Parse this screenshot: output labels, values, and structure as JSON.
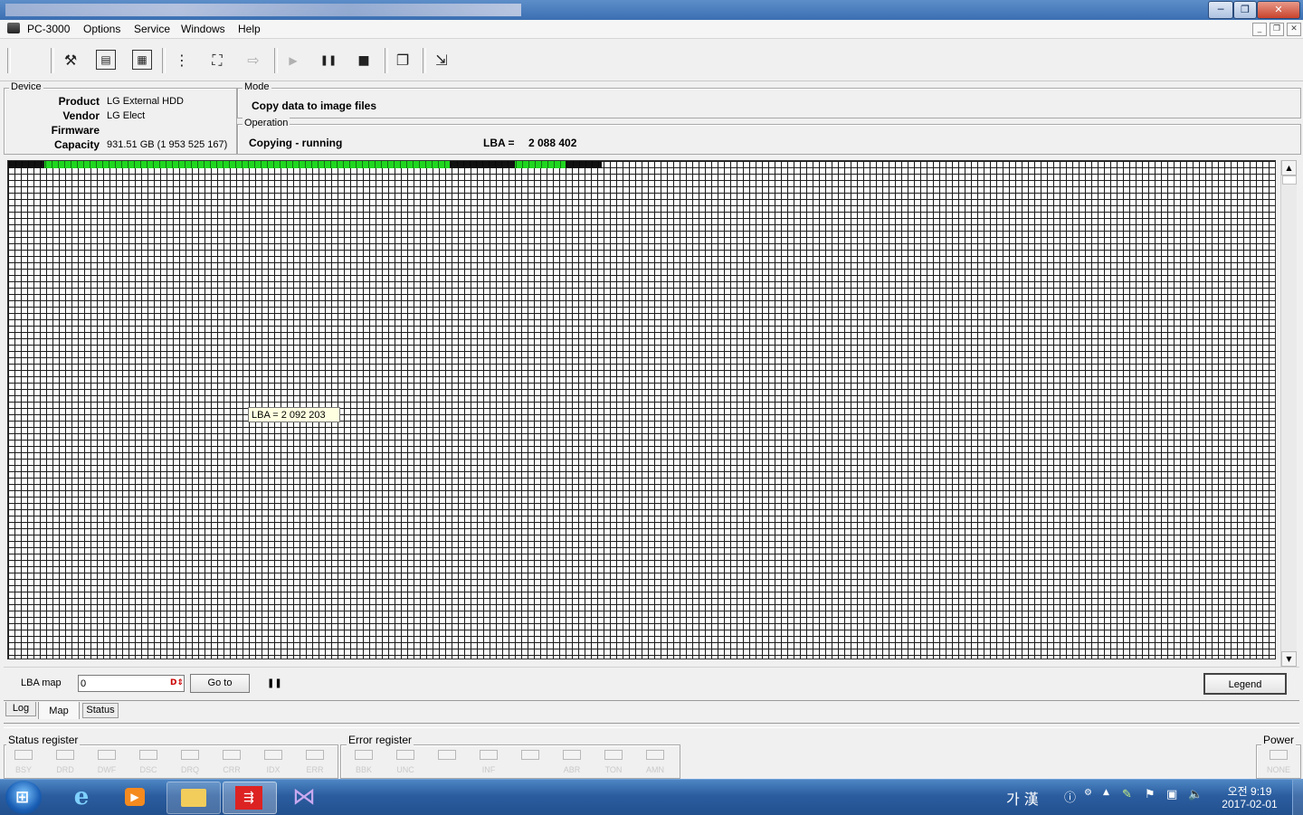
{
  "window": {
    "minimize_glyph": "─",
    "restore_glyph": "❐",
    "close_glyph": "✕"
  },
  "menubar": {
    "app_label": "PC-3000",
    "items": [
      "Options",
      "Service",
      "Windows",
      "Help"
    ],
    "mdi_minimize": "_",
    "mdi_restore": "❐",
    "mdi_close": "✕"
  },
  "toolbar": {
    "icons": [
      "tools-icon",
      "binary-chip-icon",
      "percent-chip-icon",
      "tree-icon",
      "binoculars-icon",
      "export-icon",
      "play-icon",
      "pause-icon",
      "stop-icon",
      "copy-icon",
      "exit-icon"
    ],
    "glyphs": [
      "⚒",
      "▤",
      "▦",
      "⋮",
      "⛶",
      "⇨",
      "▶",
      "❚❚",
      "■",
      "❐",
      "⇲"
    ]
  },
  "device": {
    "title": "Device",
    "product_label": "Product",
    "product_value": "LG External HDD",
    "vendor_label": "Vendor",
    "vendor_value": "LG Elect",
    "firmware_label": "Firmware",
    "firmware_value": "",
    "capacity_label": "Capacity",
    "capacity_value": "931.51 GB (1 953 525 167)"
  },
  "mode": {
    "title": "Mode",
    "value": "Copy data to image files"
  },
  "operation": {
    "title": "Operation",
    "status": "Copying - running",
    "lba_label": "LBA =",
    "lba_value": "2 088 402"
  },
  "map": {
    "tooltip": "LBA =  2 092 203",
    "colors": {
      "done": "#00cc00",
      "read": "#000000",
      "empty": "#ffffff"
    }
  },
  "map_controls": {
    "lba_map_label": "LBA map",
    "lba_input_value": "0",
    "goto_label": "Go to",
    "pause_glyph": "❚❚",
    "legend_label": "Legend"
  },
  "tabs": [
    "Log",
    "Map",
    "Status"
  ],
  "status_register": {
    "title": "Status register",
    "bits": [
      "BSY",
      "DRD",
      "DWF",
      "DSC",
      "DRQ",
      "CRR",
      "IDX",
      "ERR"
    ]
  },
  "error_register": {
    "title": "Error register",
    "bits": [
      "BBK",
      "UNC",
      "",
      "INF",
      "",
      "ABR",
      "TON",
      "AMN"
    ]
  },
  "power": {
    "title": "Power",
    "bit": "NONE"
  },
  "taskbar": {
    "clock_time": "오전 9:19",
    "clock_date": "2017-02-01",
    "ime": "가 漢"
  }
}
